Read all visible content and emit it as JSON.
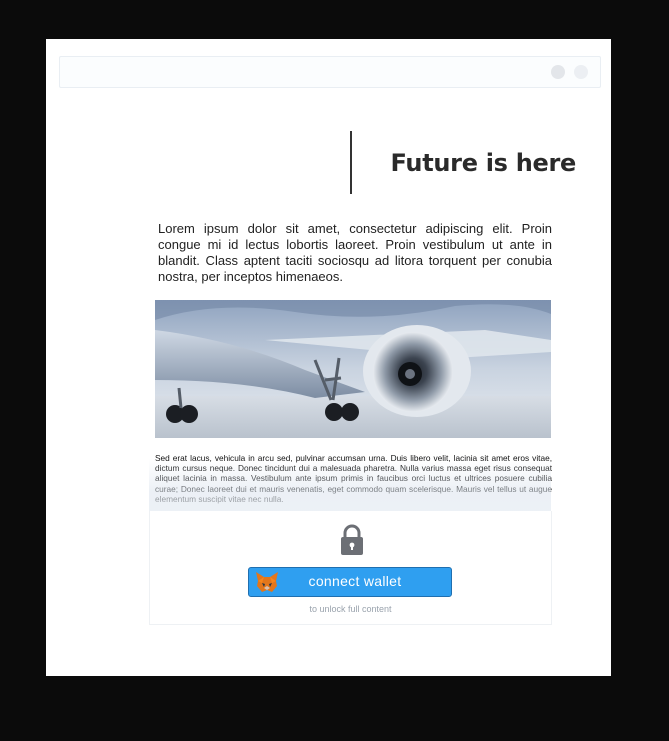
{
  "article": {
    "headline": "Future is here",
    "intro": "Lorem ipsum dolor sit amet, consectetur adipiscing elit. Proin congue mi id lectus lobortis laoreet. Proin vestibulum ut ante in blandit. Class aptent taciti sociosqu ad litora torquent per conubia nostra, per inceptos himenaeos.",
    "body": "Sed erat lacus, vehicula in arcu sed, pulvinar accumsan urna. Duis libero velit, lacinia sit amet eros vitae, dictum cursus neque. Donec tincidunt dui a malesuada pharetra. Nulla varius massa eget risus consequat aliquet lacinia in massa. Vestibulum ante ipsum primis in faucibus orci luctus et ultrices posuere cubilia curae; Donec laoreet dui et mauris venenatis, eget commodo quam scelerisque. Mauris vel tellus ut augue elementum suscipit vitae nec nulla."
  },
  "paywall": {
    "button_label": "connect wallet",
    "note": "to unlock full content",
    "lock_icon": "lock-icon",
    "wallet_icon": "metamask-fox-icon",
    "button_color": "#2f9ff0"
  }
}
